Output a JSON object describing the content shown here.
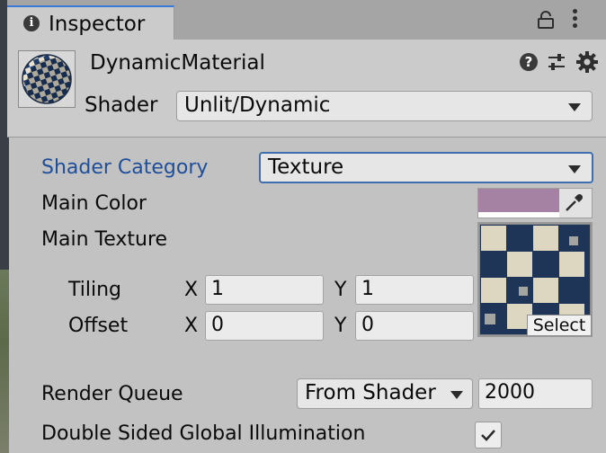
{
  "tab": {
    "label": "Inspector"
  },
  "header": {
    "material_name": "DynamicMaterial",
    "shader_label": "Shader",
    "shader_value": "Unlit/Dynamic"
  },
  "body": {
    "shader_category": {
      "label": "Shader Category",
      "value": "Texture"
    },
    "main_color": {
      "label": "Main Color",
      "color": "#a582a3"
    },
    "main_texture": {
      "label": "Main Texture",
      "select_label": "Select",
      "tiling": {
        "label": "Tiling",
        "x_label": "X",
        "x": "1",
        "y_label": "Y",
        "y": "1"
      },
      "offset": {
        "label": "Offset",
        "x_label": "X",
        "x": "0",
        "y_label": "Y",
        "y": "0"
      }
    },
    "render_queue": {
      "label": "Render Queue",
      "mode": "From Shader",
      "value": "2000"
    },
    "double_sided_gi": {
      "label": "Double Sided Global Illumination",
      "checked": true
    }
  },
  "colors": {
    "tab_accent": "#3a79d6",
    "label_blue": "#1f4e9b",
    "panel_bg": "#c2c2c2"
  },
  "icons": [
    "info-icon",
    "lock-icon",
    "menu-dots-icon",
    "help-icon",
    "preset-icon",
    "gear-icon",
    "eyedropper-icon",
    "dropdown-arrow-icon",
    "checkmark-icon"
  ]
}
